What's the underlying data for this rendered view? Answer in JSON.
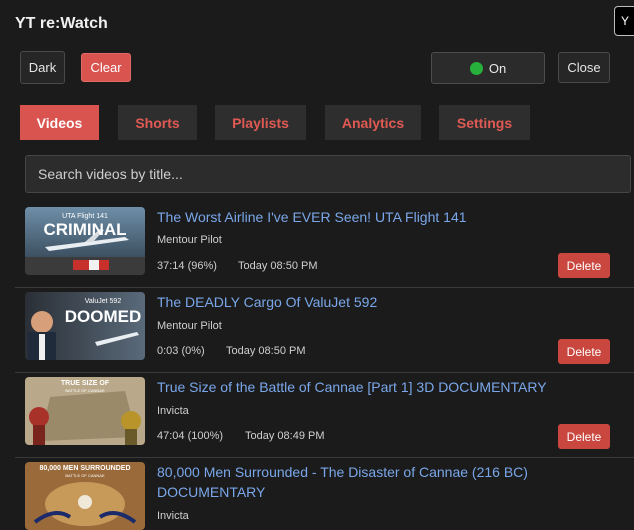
{
  "app": {
    "title": "YT re:Watch",
    "corner_tab": "Y"
  },
  "toolbar": {
    "dark_label": "Dark",
    "clear_label": "Clear",
    "toggle_label": "On",
    "close_label": "Close"
  },
  "tabs": [
    {
      "label": "Videos",
      "active": true
    },
    {
      "label": "Shorts",
      "active": false
    },
    {
      "label": "Playlists",
      "active": false
    },
    {
      "label": "Analytics",
      "active": false
    },
    {
      "label": "Settings",
      "active": false
    }
  ],
  "search": {
    "placeholder": "Search videos by title..."
  },
  "videos": [
    {
      "title": "The Worst Airline I've EVER Seen! UTA Flight 141",
      "channel": "Mentour Pilot",
      "progress": "37:14 (96%)",
      "watched": "Today 08:50 PM",
      "thumb_top": "UTA Flight 141",
      "thumb_main": "CRIMINAL",
      "delete_label": "Delete"
    },
    {
      "title": "The DEADLY Cargo Of ValuJet 592",
      "channel": "Mentour Pilot",
      "progress": "0:03 (0%)",
      "watched": "Today 08:50 PM",
      "thumb_top": "ValuJet 592",
      "thumb_main": "DOOMED",
      "delete_label": "Delete"
    },
    {
      "title": "True Size of the Battle of Cannae [Part 1] 3D DOCUMENTARY",
      "channel": "Invicta",
      "progress": "47:04 (100%)",
      "watched": "Today 08:49 PM",
      "thumb_top": "TRUE SIZE OF",
      "thumb_main": "BATTLE OF CANNAE",
      "delete_label": "Delete"
    },
    {
      "title": "80,000 Men Surrounded - The Disaster of Cannae (216 BC) DOCUMENTARY",
      "channel": "Invicta",
      "thumb_top": "80,000 MEN SURROUNDED",
      "thumb_main": "BATTLE OF CANNAE"
    }
  ]
}
